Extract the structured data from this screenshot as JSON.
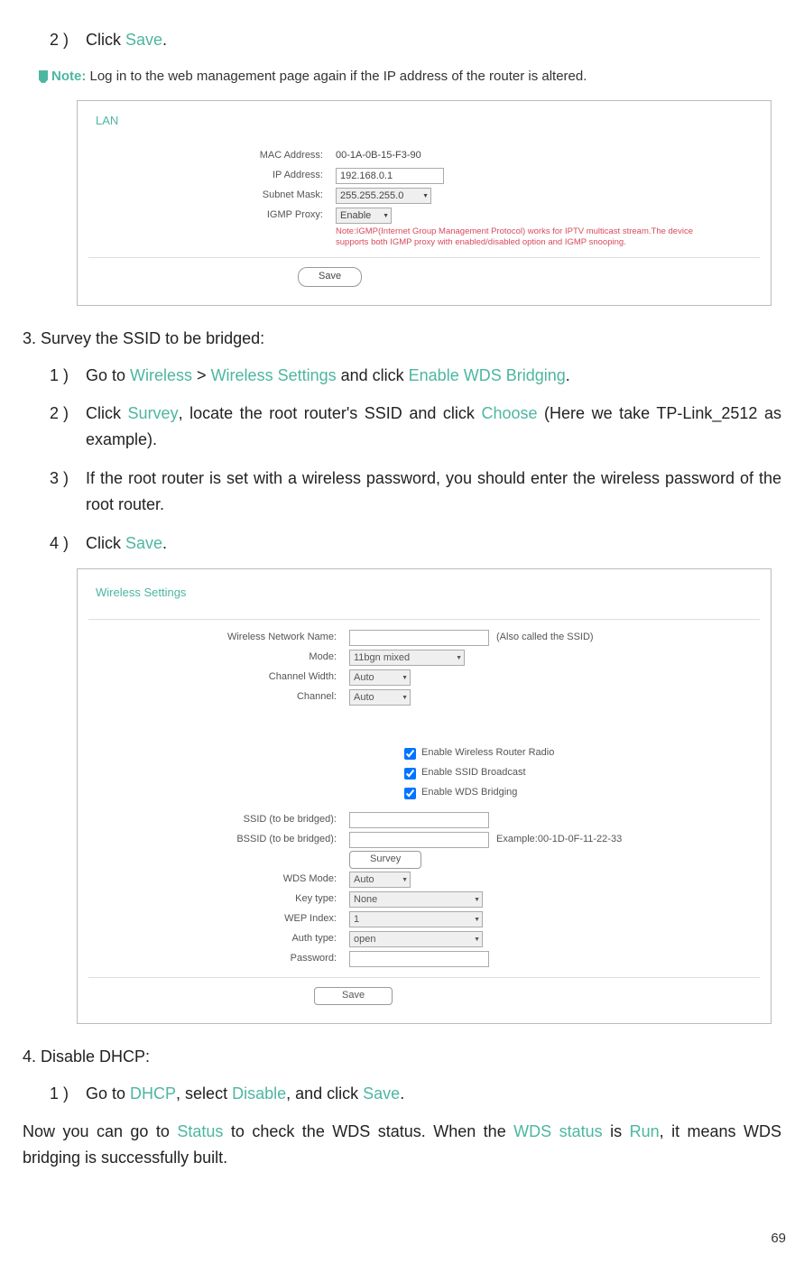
{
  "step2": {
    "num": "2 )",
    "pre": "Click ",
    "action": "Save",
    "post": "."
  },
  "note": {
    "label": "Note:",
    "text": " Log in to the web management page again if the IP address of the router is altered."
  },
  "panel1": {
    "title": "LAN",
    "rows": {
      "mac_label": "MAC Address:",
      "mac_value": "00-1A-0B-15-F3-90",
      "ip_label": "IP Address:",
      "ip_value": "192.168.0.1",
      "subnet_label": "Subnet Mask:",
      "subnet_value": "255.255.255.0",
      "igmp_label": "IGMP Proxy:",
      "igmp_value": "Enable"
    },
    "red_note": "Note:IGMP(Internet Group Management Protocol) works for IPTV multicast stream.The device supports both IGMP proxy with enabled/disabled option and IGMP snooping.",
    "save": "Save"
  },
  "section3": {
    "title": "3. Survey the SSID to be bridged:",
    "s1": {
      "num": "1 )",
      "parts": [
        "Go to ",
        "Wireless",
        " > ",
        "Wireless Settings",
        " and click ",
        "Enable WDS Bridging",
        "."
      ]
    },
    "s2": {
      "num": "2 )",
      "parts": [
        "Click ",
        "Survey",
        ", locate the root router's SSID and click ",
        "Choose",
        " (Here we take TP-Link_2512 as example)."
      ]
    },
    "s3": {
      "num": "3 )",
      "text": "If the root router is set with a wireless password, you should enter the wireless password of the root router."
    },
    "s4": {
      "num": "4 )",
      "parts": [
        "Click ",
        "Save",
        "."
      ]
    }
  },
  "panel2": {
    "title": "Wireless Settings",
    "labels": {
      "wname": "Wireless Network Name:",
      "mode": "Mode:",
      "cwidth": "Channel Width:",
      "channel": "Channel:",
      "ssid": "SSID (to be bridged):",
      "bssid": "BSSID (to be bridged):",
      "wds": "WDS Mode:",
      "key": "Key type:",
      "wep": "WEP Index:",
      "auth": "Auth type:",
      "pwd": "Password:"
    },
    "values": {
      "mode": "11bgn mixed",
      "cwidth": "Auto",
      "channel": "Auto",
      "wds": "Auto",
      "key": "None",
      "wep": "1",
      "auth": "open"
    },
    "ssid_hint": "(Also called the SSID)",
    "bssid_ex": "Example:00-1D-0F-11-22-33",
    "cb1": "Enable Wireless Router Radio",
    "cb2": "Enable SSID Broadcast",
    "cb3": "Enable WDS Bridging",
    "survey": "Survey",
    "save": "Save"
  },
  "section4": {
    "title": "4. Disable DHCP:",
    "s1": {
      "num": "1 )",
      "parts": [
        "Go to ",
        "DHCP",
        ", select ",
        "Disable",
        ", and click ",
        "Save",
        "."
      ]
    }
  },
  "closing": {
    "parts": [
      "Now you can go to ",
      "Status",
      " to check the WDS status. When the ",
      "WDS status",
      " is ",
      "Run",
      ", it means WDS bridging is successfully built."
    ]
  },
  "page": "69"
}
